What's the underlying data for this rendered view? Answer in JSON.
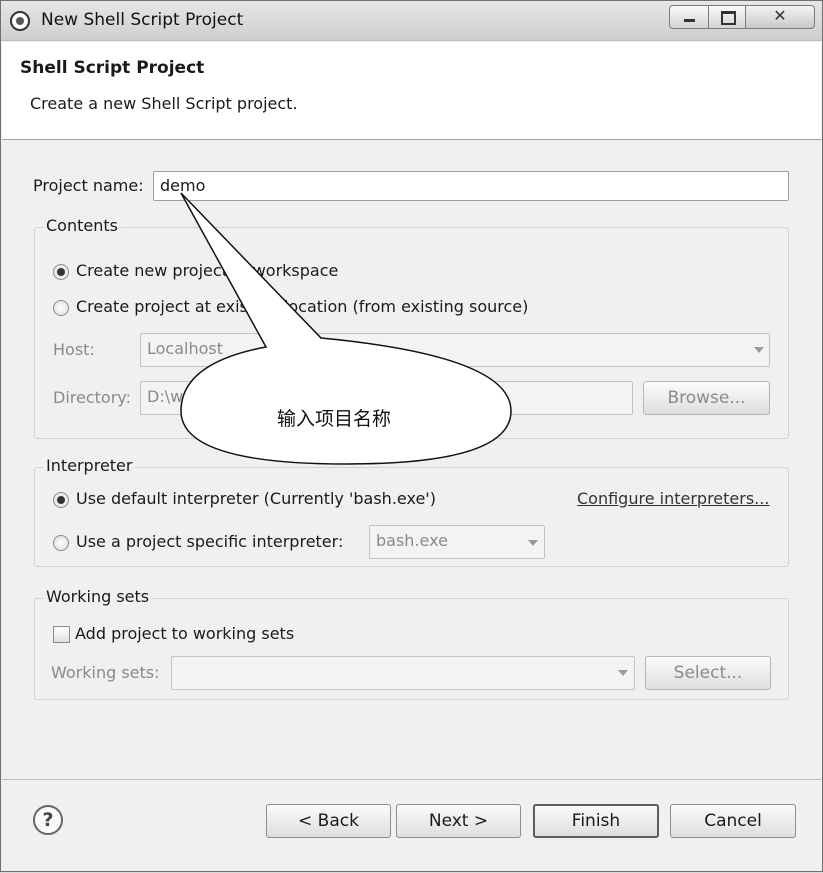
{
  "window": {
    "title": "New Shell Script Project"
  },
  "header": {
    "title": "Shell Script Project",
    "description": "Create a new Shell Script project."
  },
  "project_name": {
    "label": "Project name:",
    "value": "demo"
  },
  "contents": {
    "title": "Contents",
    "option_new": "Create new project in workspace",
    "option_existing": "Create project at existing location (from existing source)",
    "host_label": "Host:",
    "host_value": "Localhost",
    "directory_label": "Directory:",
    "directory_value": "D:\\w",
    "browse_label": "Browse..."
  },
  "interpreter": {
    "title": "Interpreter",
    "option_default": "Use default interpreter (Currently 'bash.exe')",
    "option_specific": "Use a project specific interpreter:",
    "specific_value": "bash.exe",
    "configure_link": "Configure interpreters..."
  },
  "working_sets": {
    "title": "Working sets",
    "add_label": "Add project to working sets",
    "sets_label": "Working sets:",
    "sets_value": "",
    "select_label": "Select..."
  },
  "footer": {
    "back_label": "< Back",
    "next_label": "Next >",
    "finish_label": "Finish",
    "cancel_label": "Cancel"
  },
  "annotation": {
    "text": "输入项目名称"
  }
}
